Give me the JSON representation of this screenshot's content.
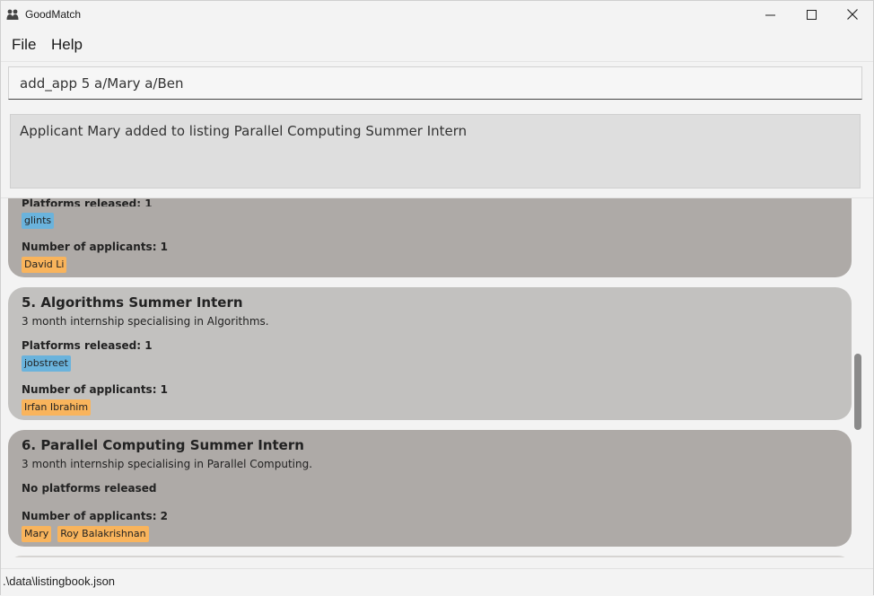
{
  "window": {
    "title": "GoodMatch"
  },
  "menu": {
    "items": [
      "File",
      "Help"
    ]
  },
  "command": {
    "value": "add_app 5 a/Mary a/Ben"
  },
  "result": {
    "message": "Applicant Mary added to listing Parallel Computing Summer Intern"
  },
  "listings": [
    {
      "partial_label": "Platforms released: 1",
      "platforms": [
        "glints"
      ],
      "applicants_label": "Number of applicants: 1",
      "applicants": [
        "David Li"
      ]
    },
    {
      "title": "5.  Algorithms Summer Intern",
      "description": "3 month internship specialising in Algorithms.",
      "platforms_label": "Platforms released: 1",
      "platforms": [
        "jobstreet"
      ],
      "applicants_label": "Number of applicants: 1",
      "applicants": [
        "Irfan Ibrahim"
      ]
    },
    {
      "title": "6.  Parallel Computing Summer Intern",
      "description": "3 month internship specialising in Parallel Computing.",
      "platforms_label": "No platforms released",
      "platforms": [],
      "applicants_label": "Number of applicants: 2",
      "applicants": [
        "Mary",
        "Roy Balakrishnan"
      ]
    }
  ],
  "status": {
    "file_path": ".\\data\\listingbook.json"
  },
  "colors": {
    "platform_tag": "#6ab3dc",
    "applicant_tag": "#f9b45c",
    "card_dark": "#aeaaa7",
    "card_light": "#c2c1bf"
  }
}
